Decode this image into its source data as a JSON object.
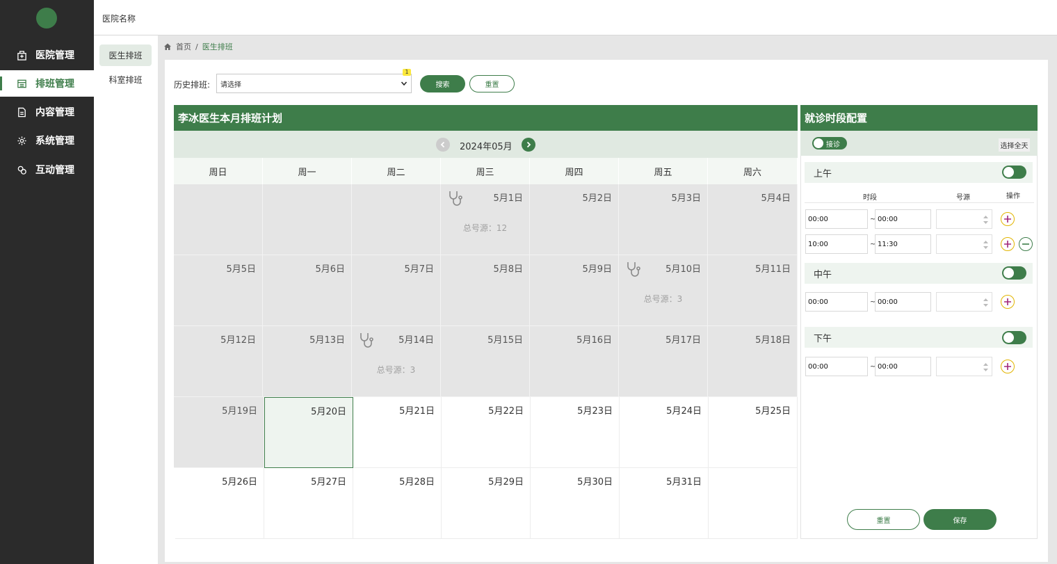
{
  "sidebar": {
    "items": [
      {
        "label": "医院管理",
        "icon": "hospital-icon"
      },
      {
        "label": "排班管理",
        "icon": "schedule-icon"
      },
      {
        "label": "内容管理",
        "icon": "document-icon"
      },
      {
        "label": "系统管理",
        "icon": "gear-icon"
      },
      {
        "label": "互动管理",
        "icon": "chat-icon"
      }
    ]
  },
  "header": {
    "hospital_name": "医院名称"
  },
  "subnav": {
    "items": [
      {
        "label": "医生排班"
      },
      {
        "label": "科室排班"
      }
    ]
  },
  "breadcrumb": {
    "home": "首页",
    "separator": "/",
    "current": "医生排班"
  },
  "filter": {
    "label": "历史排班:",
    "select_value": "请选择",
    "badge": "1",
    "search_label": "搜索",
    "reset_label": "重置"
  },
  "calendar": {
    "title": "李冰医生本月排班计划",
    "month": "2024年05月",
    "weekdays": [
      "周日",
      "周一",
      "周二",
      "周三",
      "周四",
      "周五",
      "周六"
    ],
    "days": [
      {
        "date": "5月1日",
        "total": "总号源：12"
      },
      {
        "date": "5月2日"
      },
      {
        "date": "5月3日"
      },
      {
        "date": "5月4日"
      },
      {
        "date": "5月5日"
      },
      {
        "date": "5月6日"
      },
      {
        "date": "5月7日"
      },
      {
        "date": "5月8日"
      },
      {
        "date": "5月9日"
      },
      {
        "date": "5月10日",
        "total": "总号源：3"
      },
      {
        "date": "5月11日"
      },
      {
        "date": "5月12日"
      },
      {
        "date": "5月13日"
      },
      {
        "date": "5月14日",
        "total": "总号源：3"
      },
      {
        "date": "5月15日"
      },
      {
        "date": "5月16日"
      },
      {
        "date": "5月17日"
      },
      {
        "date": "5月18日"
      },
      {
        "date": "5月19日"
      },
      {
        "date": "5月20日"
      },
      {
        "date": "5月21日"
      },
      {
        "date": "5月22日"
      },
      {
        "date": "5月23日"
      },
      {
        "date": "5月24日"
      },
      {
        "date": "5月25日"
      },
      {
        "date": "5月26日"
      },
      {
        "date": "5月27日"
      },
      {
        "date": "5月28日"
      },
      {
        "date": "5月29日"
      },
      {
        "date": "5月30日"
      },
      {
        "date": "5月31日"
      }
    ]
  },
  "config": {
    "title": "就诊时段配置",
    "receive_label": "接诊",
    "select_all_label": "选择全天",
    "columns": {
      "time": "时段",
      "quota": "号源",
      "action": "操作"
    },
    "morning": {
      "label": "上午",
      "rows": [
        {
          "start": "00:00",
          "tilde": "~",
          "end": "00:00"
        },
        {
          "start": "10:00",
          "tilde": "~",
          "end": "11:30"
        }
      ]
    },
    "noon": {
      "label": "中午",
      "rows": [
        {
          "start": "00:00",
          "tilde": "~",
          "end": "00:00"
        }
      ]
    },
    "afternoon": {
      "label": "下午",
      "rows": [
        {
          "start": "00:00",
          "tilde": "~",
          "end": "00:00"
        }
      ]
    },
    "reset_label": "重置",
    "save_label": "保存"
  },
  "colors": {
    "brand": "#3e7d4a",
    "sidebar_bg": "#2b2b2b",
    "add_accent": "#e2b400",
    "plus_glyph": "#a0267a"
  }
}
